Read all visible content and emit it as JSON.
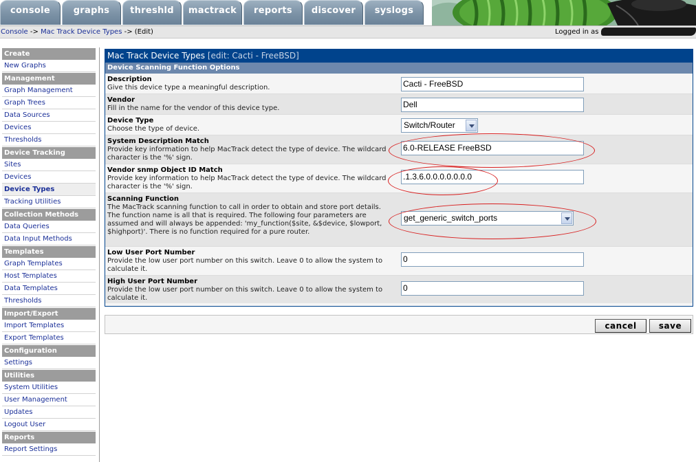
{
  "tabs": [
    "console",
    "graphs",
    "threshld",
    "mactrack",
    "reports",
    "discover",
    "syslogs"
  ],
  "breadcrumb": {
    "console": "Console",
    "sep1": " -> ",
    "device_types": "Mac Track Device Types",
    "sep2": " -> ",
    "current": "(Edit)"
  },
  "login_label": "Logged in as",
  "sidebar": [
    {
      "type": "head",
      "label": "Create"
    },
    {
      "type": "item",
      "label": "New Graphs"
    },
    {
      "type": "head",
      "label": "Management"
    },
    {
      "type": "item",
      "label": "Graph Management"
    },
    {
      "type": "item",
      "label": "Graph Trees"
    },
    {
      "type": "item",
      "label": "Data Sources"
    },
    {
      "type": "item",
      "label": "Devices"
    },
    {
      "type": "item",
      "label": "Thresholds"
    },
    {
      "type": "head",
      "label": "Device Tracking"
    },
    {
      "type": "item",
      "label": "Sites"
    },
    {
      "type": "item",
      "label": "Devices"
    },
    {
      "type": "item",
      "label": "Device Types",
      "active": true
    },
    {
      "type": "item",
      "label": "Tracking Utilities"
    },
    {
      "type": "head",
      "label": "Collection Methods"
    },
    {
      "type": "item",
      "label": "Data Queries"
    },
    {
      "type": "item",
      "label": "Data Input Methods"
    },
    {
      "type": "head",
      "label": "Templates"
    },
    {
      "type": "item",
      "label": "Graph Templates"
    },
    {
      "type": "item",
      "label": "Host Templates"
    },
    {
      "type": "item",
      "label": "Data Templates"
    },
    {
      "type": "item",
      "label": "Thresholds"
    },
    {
      "type": "head",
      "label": "Import/Export"
    },
    {
      "type": "item",
      "label": "Import Templates"
    },
    {
      "type": "item",
      "label": "Export Templates"
    },
    {
      "type": "head",
      "label": "Configuration"
    },
    {
      "type": "item",
      "label": "Settings"
    },
    {
      "type": "head",
      "label": "Utilities"
    },
    {
      "type": "item",
      "label": "System Utilities"
    },
    {
      "type": "item",
      "label": "User Management"
    },
    {
      "type": "item",
      "label": "Updates"
    },
    {
      "type": "item",
      "label": "Logout User"
    },
    {
      "type": "head",
      "label": "Reports"
    },
    {
      "type": "item",
      "label": "Report Settings"
    }
  ],
  "panel": {
    "title": "Mac Track Device Types",
    "title_sub": "[edit: Cacti - FreeBSD]",
    "subhead": "Device Scanning Function Options"
  },
  "fields": {
    "description": {
      "label": "Description",
      "help": "Give this device type a meaningful description.",
      "value": "Cacti - FreeBSD"
    },
    "vendor": {
      "label": "Vendor",
      "help": "Fill in the name for the vendor of this device type.",
      "value": "Dell"
    },
    "device_type": {
      "label": "Device Type",
      "help": "Choose the type of device.",
      "value": "Switch/Router"
    },
    "sysdescr": {
      "label": "System Description Match",
      "help": "Provide key information to help MacTrack detect the type of device. The wildcard character is the '%' sign.",
      "value": "6.0-RELEASE FreeBSD"
    },
    "sysoid": {
      "label": "Vendor snmp Object ID Match",
      "help": "Provide key information to help MacTrack detect the type of device. The wildcard character is the '%' sign.",
      "value": ".1.3.6.0.0.0.0.0.0.0"
    },
    "scan_function": {
      "label": "Scanning Function",
      "help": "The MacTrack scanning function to call in order to obtain and store port details. The function name is all that is required. The following four parameters are assumed and will always be appended: 'my_function($site, &$device, $lowport, $highport)'. There is no function required for a pure router.",
      "value": "get_generic_switch_ports"
    },
    "lowport": {
      "label": "Low User Port Number",
      "help": "Provide the low user port number on this switch. Leave 0 to allow the system to calculate it.",
      "value": "0"
    },
    "highport": {
      "label": "High User Port Number",
      "help": "Provide the low user port number on this switch. Leave 0 to allow the system to calculate it.",
      "value": "0"
    }
  },
  "buttons": {
    "cancel": "cancel",
    "save": "save"
  },
  "colors": {
    "panel_header": "#00438c",
    "subheader": "#6d88ad",
    "sidebar_head": "#9c9c9c",
    "link": "#1a2f98",
    "annotation": "#d81e1e"
  }
}
